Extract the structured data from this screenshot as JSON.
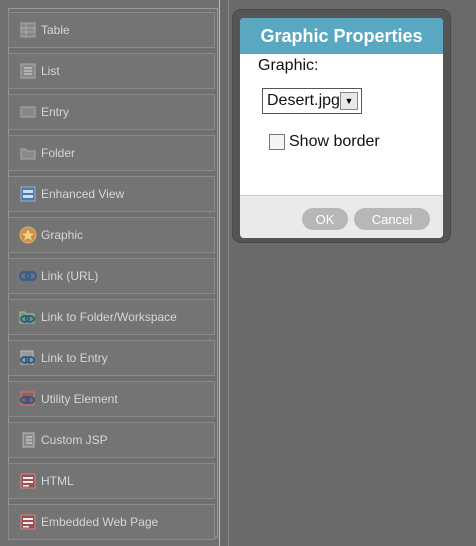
{
  "palette": {
    "items": [
      {
        "label": "Table",
        "icon": "table-icon"
      },
      {
        "label": "List",
        "icon": "list-icon"
      },
      {
        "label": "Entry",
        "icon": "entry-icon"
      },
      {
        "label": "Folder",
        "icon": "folder-icon"
      },
      {
        "label": "Enhanced View",
        "icon": "enhanced-view-icon"
      },
      {
        "label": "Graphic",
        "icon": "graphic-icon"
      },
      {
        "label": "Link (URL)",
        "icon": "link-icon"
      },
      {
        "label": "Link to Folder/Workspace",
        "icon": "link-folder-icon"
      },
      {
        "label": "Link to Entry",
        "icon": "link-entry-icon"
      },
      {
        "label": "Utility Element",
        "icon": "utility-icon"
      },
      {
        "label": "Custom JSP",
        "icon": "custom-jsp-icon"
      },
      {
        "label": "HTML",
        "icon": "html-icon"
      },
      {
        "label": "Embedded Web Page",
        "icon": "embedded-page-icon"
      }
    ]
  },
  "dialog": {
    "title": "Graphic Properties",
    "graphic_label": "Graphic:",
    "graphic_value": "Desert.jpg",
    "show_border_label": "Show border",
    "show_border_checked": false,
    "ok_label": "OK",
    "cancel_label": "Cancel"
  },
  "colors": {
    "title_bar": "#5aa7c2",
    "background": "#6a6a6a",
    "button": "#b7b7b7"
  }
}
